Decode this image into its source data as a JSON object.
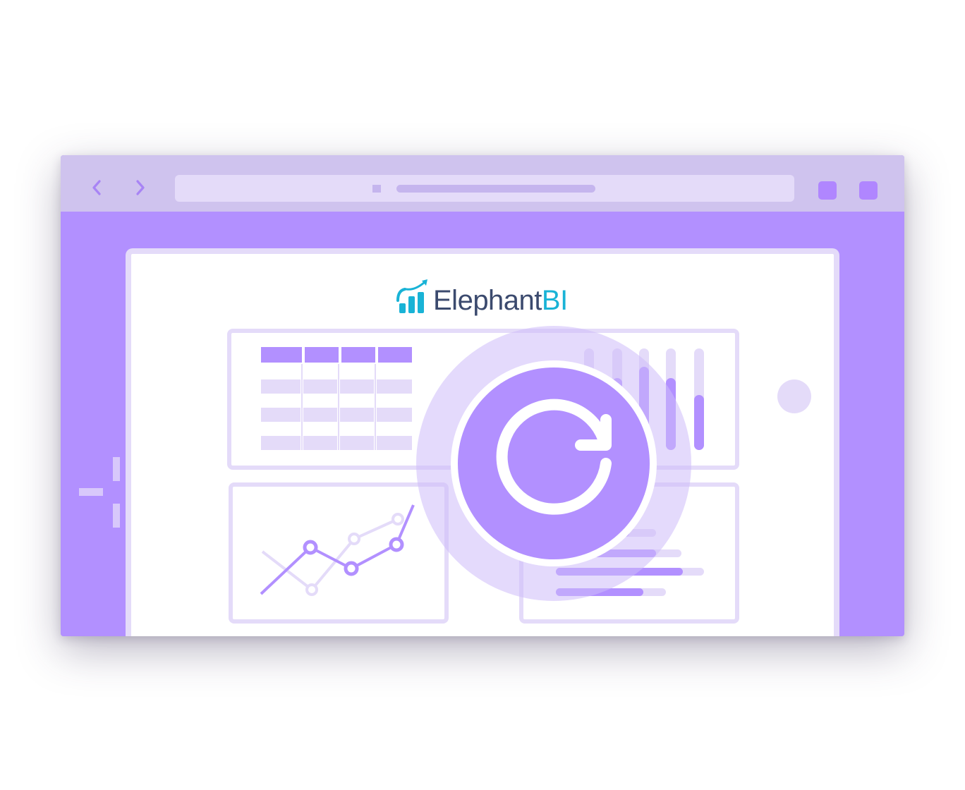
{
  "logo": {
    "text_main": "Elephant",
    "text_accent": "BI"
  },
  "colors": {
    "accent": "#b290ff",
    "toolbar": "#cfc3ee",
    "light": "#e4dbf9",
    "logo_dark": "#3b4a6e",
    "logo_teal": "#19b3d6"
  },
  "icons": {
    "back": "chevron-left-icon",
    "forward": "chevron-right-icon",
    "refresh": "refresh-icon"
  }
}
